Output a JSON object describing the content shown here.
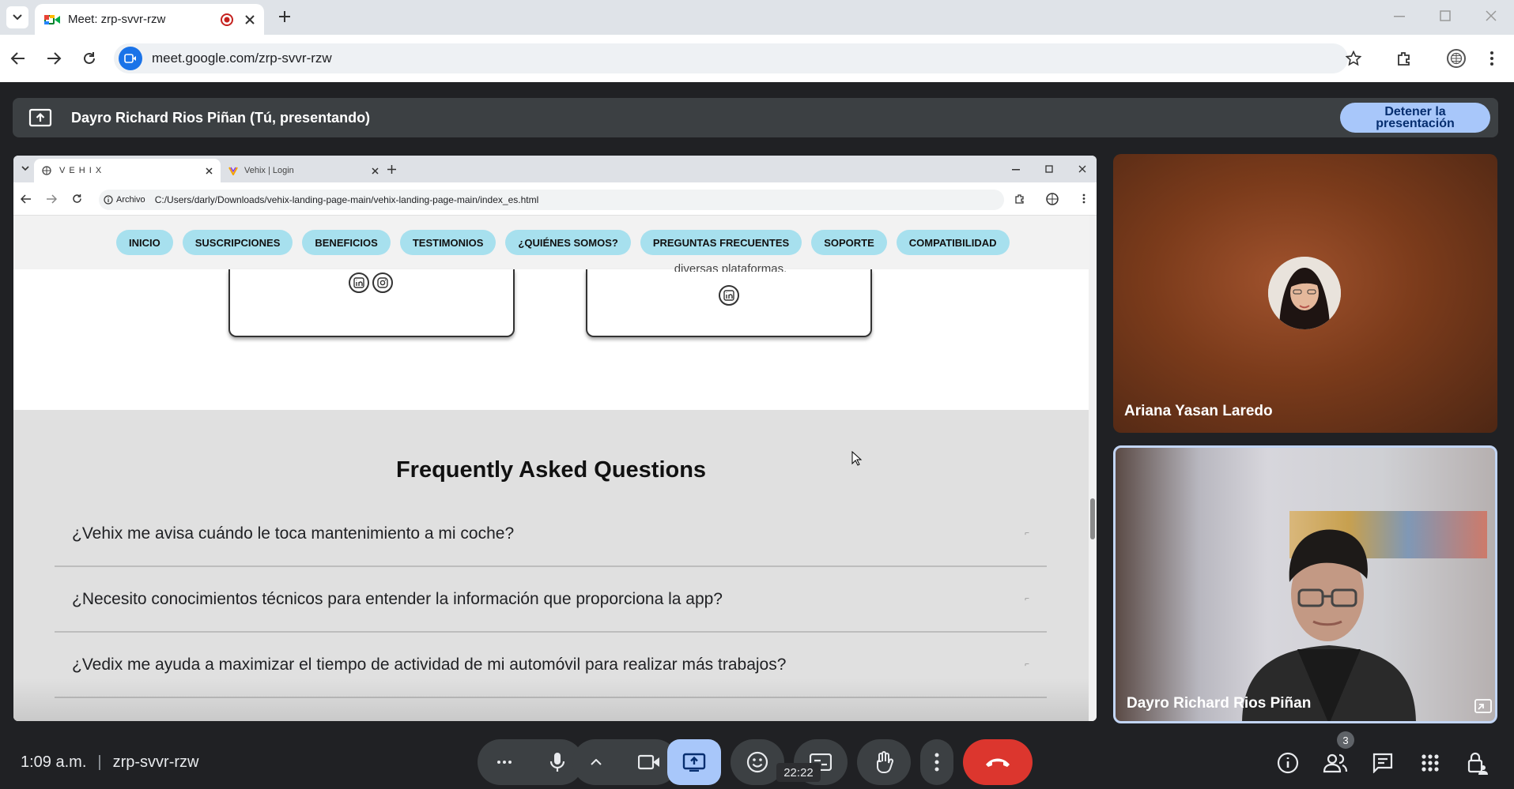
{
  "browser": {
    "tab_title": "Meet: zrp-svvr-rzw",
    "url": "meet.google.com/zrp-svvr-rzw"
  },
  "meet_bar": {
    "presenter_label": "Dayro Richard Rios Piñan (Tú, presentando)",
    "stop_line1": "Detener la",
    "stop_line2": "presentación"
  },
  "shared": {
    "tabs": [
      {
        "title": "V E H I X"
      },
      {
        "title": "Vehix | Login"
      }
    ],
    "omnibox_chip": "Archivo",
    "url": "C:/Users/darly/Downloads/vehix-landing-page-main/vehix-landing-page-main/index_es.html",
    "nav": [
      "INICIO",
      "SUSCRIPCIONES",
      "BENEFICIOS",
      "TESTIMONIOS",
      "¿QUIÉNES SOMOS?",
      "PREGUNTAS FRECUENTES",
      "SOPORTE",
      "COMPATIBILIDAD"
    ],
    "card_partial_text": "diversas plataformas.",
    "faq_title": "Frequently Asked Questions",
    "faq": [
      "¿Vehix me avisa cuándo le toca mantenimiento a mi coche?",
      "¿Necesito conocimientos técnicos para entender la información que proporciona la app?",
      "¿Vedix me ayuda a maximizar el tiempo de actividad de mi automóvil para realizar más trabajos?"
    ]
  },
  "participants": [
    {
      "name": "Ariana Yasan Laredo"
    },
    {
      "name": "Dayro Richard Rios Piñan"
    }
  ],
  "bottom": {
    "time": "1:09 a.m.",
    "separator": "|",
    "meeting_code": "zrp-svvr-rzw",
    "timer_tooltip": "22:22",
    "people_count": "3"
  },
  "colors": {
    "accent": "#a8c7fa",
    "end_call": "#dc362e",
    "nav_pill": "#a7e0ee",
    "present_active": "#a8c7fa"
  }
}
